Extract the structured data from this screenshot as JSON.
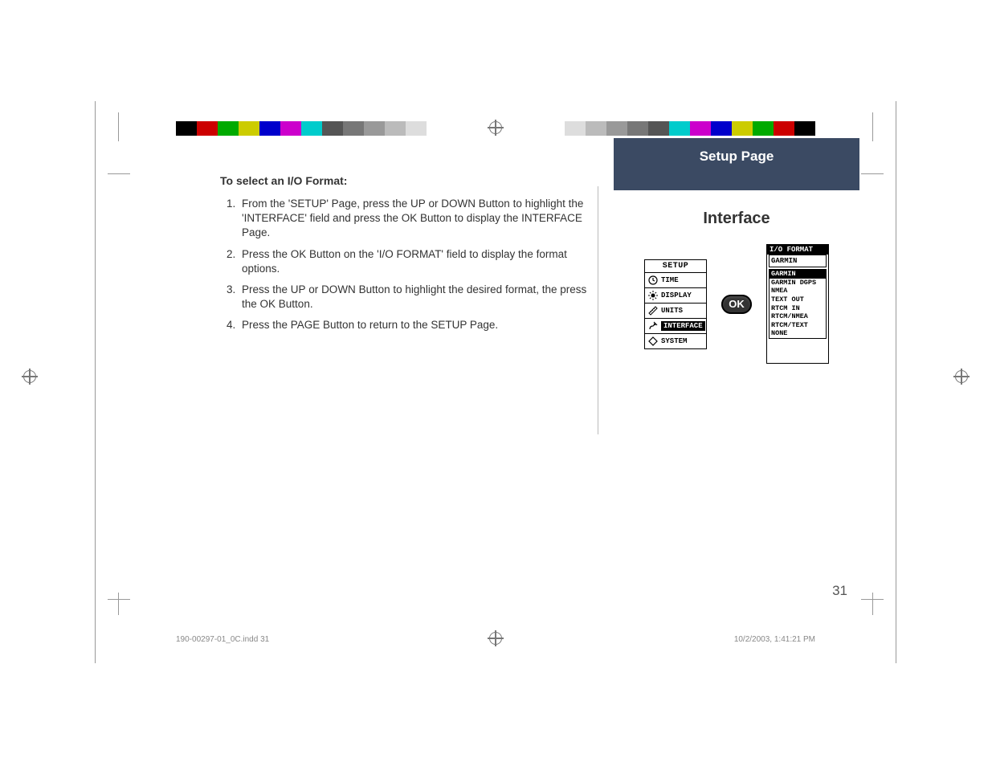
{
  "instructions": {
    "title": "To select an I/O Format:",
    "steps": [
      "From the 'SETUP' Page, press the <b>UP</b> or <b>DOWN</b> Button to highlight the 'INTERFACE' field and press the <b>OK</b> Button to display the INTERFACE Page.",
      "Press the <b>OK</b> Button on the 'I/O FORMAT' field to display the format options.",
      "Press the <b>UP</b> or <b>DOWN</b> Button to highlight the desired format, the press the <b>OK</b> Button.",
      "Press the <b>PAGE</b> Button to return to the SETUP Page."
    ]
  },
  "sidebar": {
    "header": "Setup Page",
    "section": "Interface"
  },
  "setup_menu": {
    "title": "SETUP",
    "items": [
      {
        "label": "TIME",
        "icon": "clock"
      },
      {
        "label": "DISPLAY",
        "icon": "sun"
      },
      {
        "label": "UNITS",
        "icon": "ruler"
      },
      {
        "label": "INTERFACE",
        "icon": "plug",
        "selected": true
      },
      {
        "label": "SYSTEM",
        "icon": "diamond"
      }
    ]
  },
  "ok_button": {
    "label": "OK"
  },
  "io_format": {
    "header": "I/O FORMAT",
    "current": "GARMIN",
    "options": [
      "GARMIN",
      "GARMIN DGPS",
      "NMEA",
      "TEXT OUT",
      "RTCM IN",
      "RTCM/NMEA",
      "RTCM/TEXT",
      "NONE"
    ],
    "selected_index": 0
  },
  "page_number": "31",
  "footer": {
    "left": "190-00297-01_0C.indd   31",
    "right": "10/2/2003, 1:41:21 PM"
  },
  "colorbar_left": [
    "#000",
    "#c00",
    "#0a0",
    "#cc0",
    "#00c",
    "#c0c",
    "#0cc",
    "#555",
    "#777",
    "#999",
    "#bbb",
    "#ddd",
    "#fff"
  ],
  "colorbar_right": [
    "#fff",
    "#ddd",
    "#bbb",
    "#999",
    "#777",
    "#555",
    "#0cc",
    "#c0c",
    "#00c",
    "#cc0",
    "#0a0",
    "#c00",
    "#000"
  ]
}
